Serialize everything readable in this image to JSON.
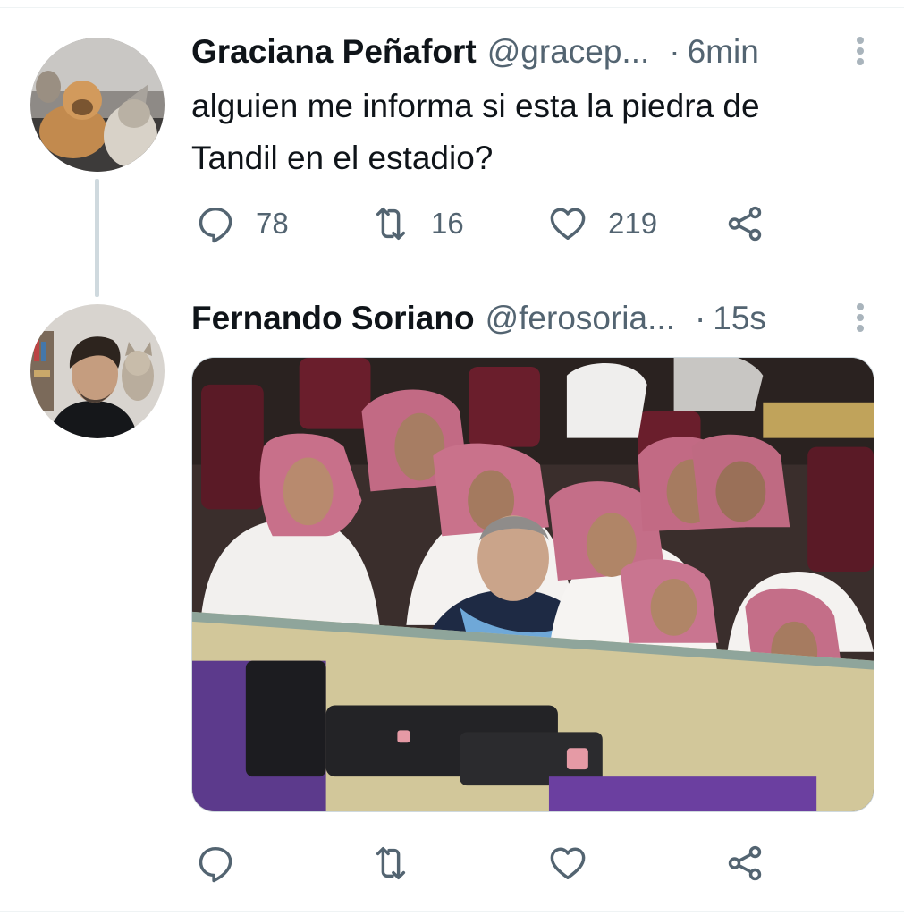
{
  "tweets": [
    {
      "display_name": "Graciana Peñafort",
      "handle": "@gracep...",
      "separator": "·",
      "time": "6min",
      "text_lines": [
        "alguien me informa si esta la piedra de",
        "Tandil en el estadio?"
      ],
      "avatar": "profile-photo-dogs",
      "counts": {
        "reply": "78",
        "retweet": "16",
        "like": "219"
      }
    },
    {
      "display_name": "Fernando Soriano",
      "handle": "@ferosoria...",
      "separator": "·",
      "time": "15s",
      "avatar": "profile-photo-man-with-cat",
      "media": "photo-stadium-crowd",
      "counts": {
        "reply": "",
        "retweet": "",
        "like": ""
      }
    }
  ],
  "icons": {
    "reply": "reply-icon",
    "retweet": "retweet-icon",
    "like": "heart-icon",
    "share": "share-icon",
    "more": "more-vertical-icon"
  },
  "colors": {
    "text": "#0f1419",
    "secondary": "#536471",
    "thread_line": "#cfd9de"
  }
}
